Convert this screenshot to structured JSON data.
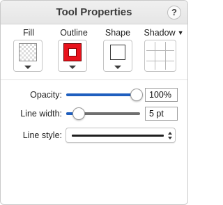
{
  "window": {
    "title": "Tool Properties",
    "help_label": "?"
  },
  "tools": {
    "fill": {
      "label": "Fill",
      "swatch": "transparent-checker"
    },
    "outline": {
      "label": "Outline",
      "color": "#e8121c"
    },
    "shape": {
      "label": "Shape",
      "icon": "square-outline-icon"
    },
    "shadow": {
      "label": "Shadow",
      "menu_arrow": "▼",
      "icon": "grid-icon"
    }
  },
  "opacity": {
    "label": "Opacity:",
    "value": "100%",
    "fraction": 1.0
  },
  "line_width": {
    "label": "Line width:",
    "value": "5 pt",
    "fraction": 0.0
  },
  "line_style": {
    "label": "Line style:",
    "selected": "solid-line"
  },
  "colors": {
    "accent": "#1f5fbf",
    "track_inactive": "#6f6f6f",
    "outline": "#e8121c"
  }
}
